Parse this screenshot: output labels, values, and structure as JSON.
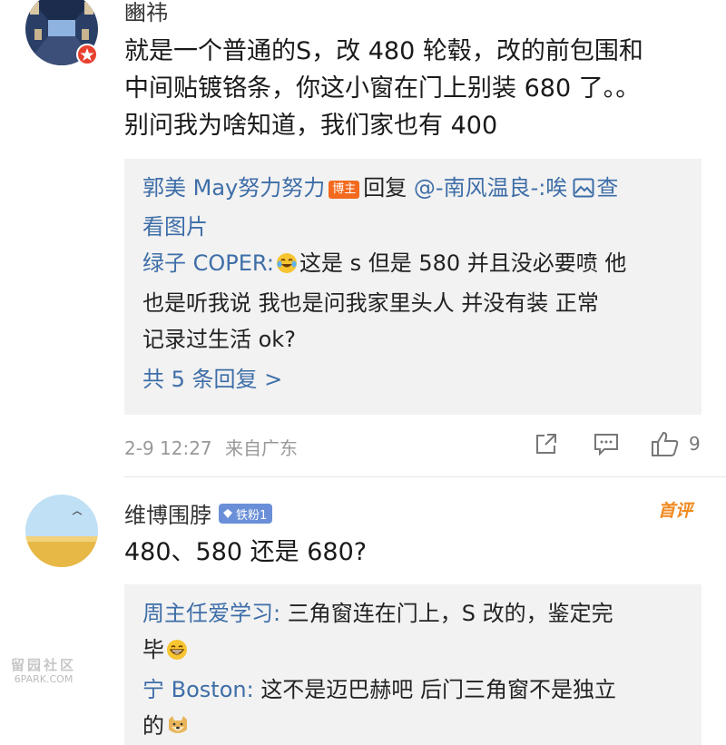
{
  "comment1": {
    "username": "豳祎",
    "body_lines": [
      "就是一个普通的S，改 480 轮毂，改的前包围和",
      "中间贴镀铬条，你这小窗在门上别装 680 了。。",
      "别问我为啥知道，我们家也有 400"
    ],
    "reply_box": {
      "r1_author": "郭美 May努力努力",
      "r1_badge": "博主",
      "r1_text": "回复",
      "r1_mention": "@-南风温良-:唉",
      "r1_link1": "查",
      "r1_link2": "看图片",
      "r2_author": "绿子 COPER:",
      "r2_line1": "这是 s 但是 580 并且没必要喷 他",
      "r2_line2": "也是听我说 我也是问我家里头人 并没有装 正常",
      "r2_line3": "记录过生活 ok?",
      "more": "共 5 条回复 >"
    },
    "timestamp": "2-9 12:27",
    "source": "来自广东",
    "like_count": "9"
  },
  "comment2": {
    "username": "维博围脖",
    "fan_badge": "铁粉1",
    "first_badge": "首评",
    "body": "480、580 还是 680?",
    "reply_box": {
      "r1_author": "周主任爱学习:",
      "r1_line1": "三角窗连在门上，S 改的，鉴定完",
      "r1_line2": "毕",
      "r2_author": "宁 Boston:",
      "r2_line1": "这不是迈巴赫吧 后门三角窗不是独立",
      "r2_line2": "的"
    }
  },
  "watermark": {
    "cn": "留园社区",
    "en": "6PARK.COM"
  },
  "icons": {
    "verified_badge": "red-verified-badge-icon",
    "image": "image-icon",
    "share": "share-icon",
    "comment": "comment-icon",
    "like": "thumbs-up-icon",
    "laugh_cry": "laughing-crying-emoji-icon",
    "grin": "grin-emoji-icon",
    "doge": "doge-emoji-icon"
  },
  "colors": {
    "link_blue": "#3e6ea8",
    "host_badge": "#f36a1e",
    "fan_badge": "#6a8fd8",
    "first_comment": "#f08a20",
    "reply_bg": "#f2f2f2",
    "meta_gray": "#999999"
  }
}
